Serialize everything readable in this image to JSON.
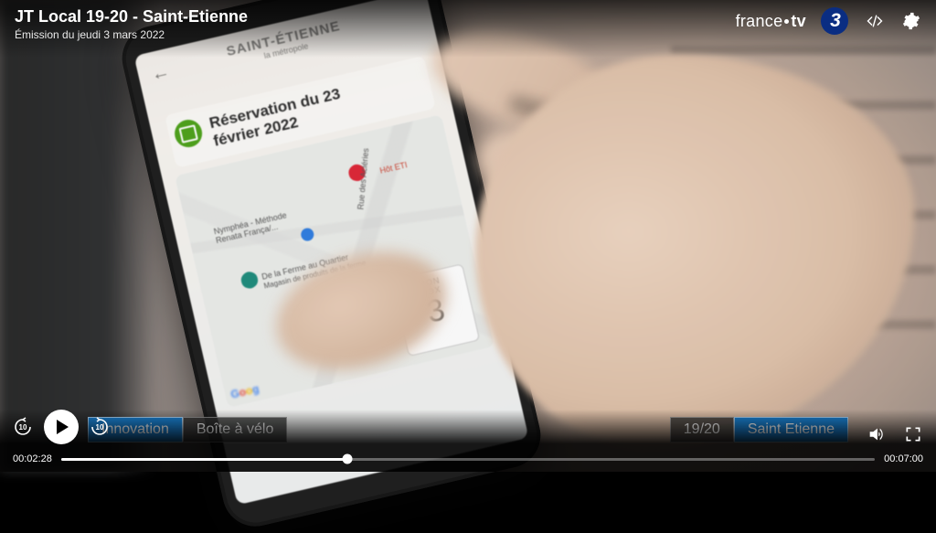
{
  "header": {
    "title": "JT Local 19-20 - Saint-Etienne",
    "subtitle": "Émission du jeudi 3 mars 2022",
    "brand_a": "france",
    "brand_b": "tv",
    "channel_number": "3"
  },
  "lower_third": {
    "left_a": "Innovation",
    "left_b": "Boîte à vélo",
    "right_a": "19/20",
    "right_b": "Saint Etienne"
  },
  "player": {
    "skip_back_label": "10",
    "skip_fwd_label": "10",
    "elapsed": "00:02:28",
    "duration": "00:07:00",
    "progress_percent": 35.2
  },
  "phone": {
    "app_title": "SAINT-ÉTIENNE",
    "app_subtitle": "la métropole",
    "reservation_line1": "Réservation du 23",
    "reservation_line2": "février 2022",
    "map": {
      "label1": "Nymphéa - Méthode Renata França/...",
      "label2": "De la Ferme au Quartier",
      "label2_sub": "Magasin de produits de la ferme",
      "label3": "Rue des Aciéries",
      "label4": "Hôt ETI",
      "google": [
        "G",
        "o",
        "o",
        "g"
      ]
    },
    "box": {
      "line1": "MON",
      "line2": "BOX",
      "number": "3"
    }
  }
}
